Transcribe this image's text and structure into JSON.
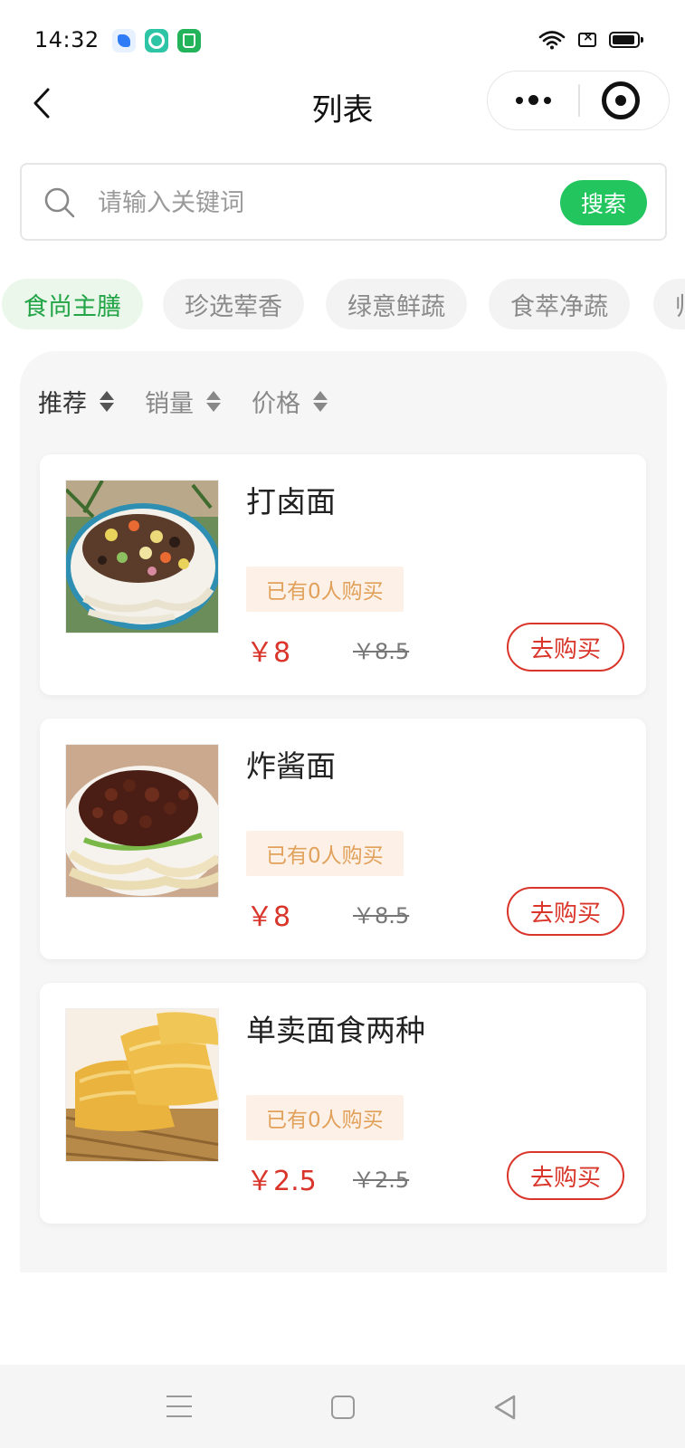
{
  "status_bar": {
    "time": "14:32"
  },
  "nav": {
    "title": "列表"
  },
  "search": {
    "placeholder": "请输入关键词",
    "button": "搜索"
  },
  "categories": [
    "食尚主膳",
    "珍选荤香",
    "绿意鲜蔬",
    "食萃净蔬",
    "帅"
  ],
  "active_category": "食尚主膳",
  "sort": [
    {
      "label": "推荐",
      "active": true
    },
    {
      "label": "销量",
      "active": false
    },
    {
      "label": "价格",
      "active": false
    }
  ],
  "products": [
    {
      "name": "打卤面",
      "sold": "已有0人购买",
      "price": "￥8",
      "original_price": "￥8.5",
      "button": "去购买"
    },
    {
      "name": "炸酱面",
      "sold": "已有0人购买",
      "price": "￥8",
      "original_price": "￥8.5",
      "button": "去购买"
    },
    {
      "name": "单卖面食两种",
      "sold": "已有0人购买",
      "price": "￥2.5",
      "original_price": "￥2.5",
      "button": "去购买"
    }
  ],
  "colors": {
    "accent_green": "#22c55e",
    "price_red": "#d9352a",
    "badge_orange": "#e1a15b"
  }
}
